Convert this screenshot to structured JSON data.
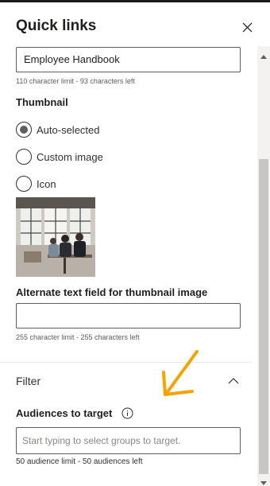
{
  "header": {
    "title": "Quick links",
    "close_icon": "close-icon"
  },
  "title_field": {
    "value": "Employee Handbook",
    "hint": "110 character limit - 93 characters left"
  },
  "thumbnail": {
    "label": "Thumbnail",
    "options": [
      {
        "label": "Auto-selected",
        "checked": true
      },
      {
        "label": "Custom image",
        "checked": false
      },
      {
        "label": "Icon",
        "checked": false
      }
    ],
    "image": "office-meeting-photo"
  },
  "alt_text": {
    "label": "Alternate text field for thumbnail image",
    "value": "",
    "hint": "255 character limit - 255 characters left"
  },
  "filter": {
    "title": "Filter",
    "expanded": true,
    "audiences_label": "Audiences to target",
    "info_icon": "info-icon",
    "placeholder": "Start typing to select groups to target.",
    "hint": "50 audience limit - 50 audiences left"
  },
  "annotation": {
    "icon": "arrow-down-left-icon",
    "color": "#f5a300"
  },
  "colors": {
    "border": "#605e5c",
    "text": "#323130",
    "scroll_thumb": "#c8c6c4"
  }
}
